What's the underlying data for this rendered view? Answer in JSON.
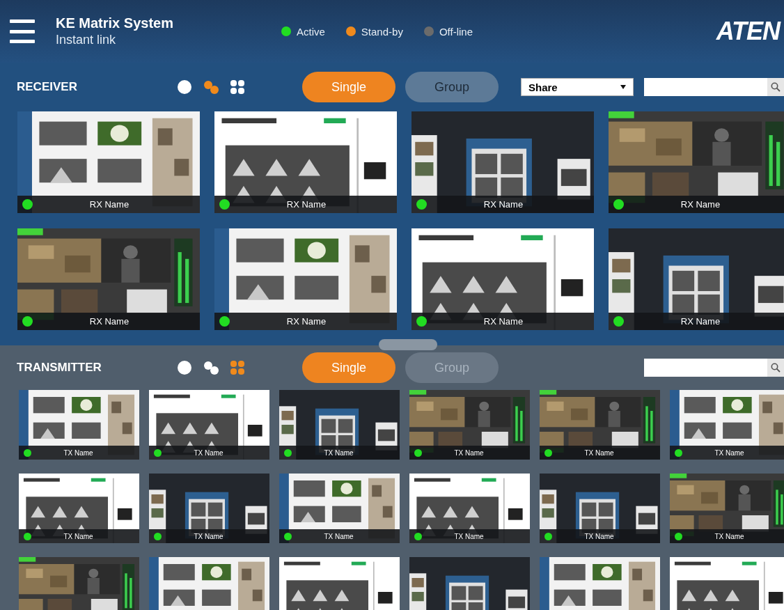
{
  "header": {
    "title": "KE Matrix System",
    "subtitle": "Instant link",
    "logo": "ATEN",
    "legend": [
      {
        "label": "Active",
        "color": "#22dd22"
      },
      {
        "label": "Stand-by",
        "color": "#f08a1c"
      },
      {
        "label": "Off-line",
        "color": "#6b6b6b"
      }
    ]
  },
  "receiver": {
    "title": "RECEIVER",
    "views": [
      {
        "kind": "single",
        "selected": false
      },
      {
        "kind": "pair",
        "selected": true
      },
      {
        "kind": "quad",
        "selected": false
      }
    ],
    "modes": [
      {
        "label": "Single",
        "selected": true,
        "disabled": false
      },
      {
        "label": "Group",
        "selected": false,
        "disabled": false
      }
    ],
    "filter": {
      "value": "Share"
    },
    "tiles": [
      {
        "name": "RX Name",
        "color": "#22dd22"
      },
      {
        "name": "RX Name",
        "color": "#22dd22"
      },
      {
        "name": "RX Name",
        "color": "#22dd22"
      },
      {
        "name": "RX Name",
        "color": "#22dd22"
      },
      {
        "name": "RX Name",
        "color": "#22dd22"
      },
      {
        "name": "RX Name",
        "color": "#22dd22"
      },
      {
        "name": "RX Name",
        "color": "#22dd22"
      },
      {
        "name": "RX Name",
        "color": "#22dd22"
      }
    ]
  },
  "transmitter": {
    "title": "TRANSMITTER",
    "views": [
      {
        "kind": "single",
        "selected": false
      },
      {
        "kind": "pair",
        "selected": false
      },
      {
        "kind": "quad",
        "selected": true
      }
    ],
    "modes": [
      {
        "label": "Single",
        "selected": true,
        "disabled": false
      },
      {
        "label": "Group",
        "selected": false,
        "disabled": true
      }
    ],
    "tiles": [
      {
        "name": "TX Name",
        "color": "#22dd22"
      },
      {
        "name": "TX Name",
        "color": "#22dd22"
      },
      {
        "name": "TX Name",
        "color": "#22dd22"
      },
      {
        "name": "TX Name",
        "color": "#22dd22"
      },
      {
        "name": "TX Name",
        "color": "#22dd22"
      },
      {
        "name": "TX Name",
        "color": "#22dd22"
      },
      {
        "name": "TX Name",
        "color": "#22dd22"
      },
      {
        "name": "TX Name",
        "color": "#22dd22"
      },
      {
        "name": "TX Name",
        "color": "#22dd22"
      },
      {
        "name": "TX Name",
        "color": "#22dd22"
      },
      {
        "name": "TX Name",
        "color": "#22dd22"
      },
      {
        "name": "TX Name",
        "color": "#22dd22"
      },
      {
        "kind": "picture"
      },
      {
        "kind": "picture"
      },
      {
        "kind": "picture"
      },
      {
        "kind": "picture"
      },
      {
        "kind": "picture"
      },
      {
        "kind": "picture"
      }
    ]
  }
}
